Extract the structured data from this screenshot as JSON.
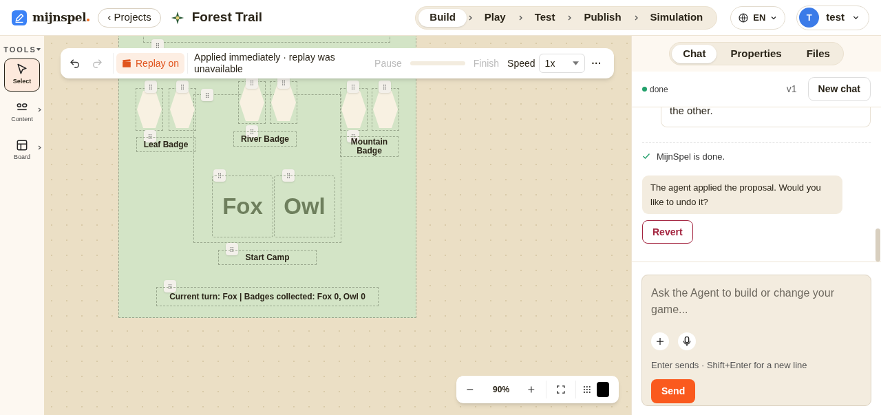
{
  "header": {
    "brand": "mijnspel",
    "projects_button": "‹ Projects",
    "project_title": "Forest Trail",
    "steps": [
      {
        "label": "Build",
        "selected": true
      },
      {
        "label": "Play",
        "selected": false
      },
      {
        "label": "Test",
        "selected": false
      },
      {
        "label": "Publish",
        "selected": false
      },
      {
        "label": "Simulation",
        "selected": false
      }
    ],
    "language": "EN",
    "user": {
      "initial": "T",
      "name": "test"
    }
  },
  "tools": {
    "title": "TOOLS",
    "items": [
      {
        "label": "Select",
        "selected": true,
        "kind": "select"
      },
      {
        "label": "Content",
        "selected": false,
        "kind": "content"
      },
      {
        "label": "Board",
        "selected": false,
        "kind": "board"
      }
    ]
  },
  "replay_bar": {
    "replay": "Replay on",
    "message": "Applied immediately · replay was unavailable",
    "pause": "Pause",
    "finish": "Finish",
    "speed_label": "Speed",
    "speed": "1x",
    "more": "···"
  },
  "board": {
    "badges": [
      {
        "label": "Leaf Badge"
      },
      {
        "label": "River Badge"
      },
      {
        "label": "Mountain Badge"
      }
    ],
    "tokens": [
      "Fox",
      "Owl"
    ],
    "start": "Start Camp",
    "status": "Current turn: Fox | Badges collected: Fox 0, Owl 0"
  },
  "zoom_controls": {
    "zoom": "90%"
  },
  "panel": {
    "tabs": [
      {
        "label": "Chat",
        "selected": true
      },
      {
        "label": "Properties",
        "selected": false
      },
      {
        "label": "Files",
        "selected": false
      }
    ],
    "status": {
      "label": "done",
      "color": "#22a06b"
    },
    "version": "v1",
    "new_chat": "New chat",
    "messages": [
      {
        "kind": "user",
        "text": "the other."
      },
      {
        "kind": "system",
        "text": "MijnSpel is done."
      },
      {
        "kind": "agent",
        "text": "The agent applied the proposal. Would you like to undo it?"
      }
    ],
    "revert": "Revert",
    "composer": {
      "placeholder": "Ask the Agent to build or change your game...",
      "hint": "Enter sends · Shift+Enter for a new line",
      "send": "Send"
    }
  }
}
